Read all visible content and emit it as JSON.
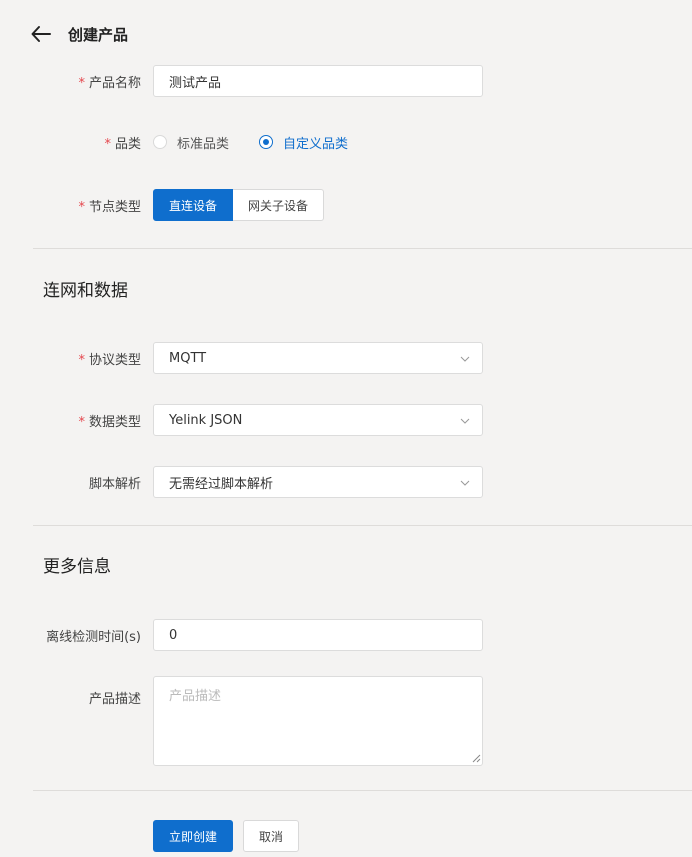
{
  "header": {
    "title": "创建产品",
    "back_icon": "arrow-left-icon"
  },
  "basic": {
    "product_name": {
      "label": "产品名称",
      "required": "*",
      "value": "测试产品"
    },
    "category": {
      "label": "品类",
      "required": "*",
      "options": [
        {
          "label": "标准品类",
          "checked": false
        },
        {
          "label": "自定义品类",
          "checked": true
        }
      ]
    },
    "node_type": {
      "label": "节点类型",
      "required": "*",
      "options": [
        {
          "label": "直连设备",
          "active": true
        },
        {
          "label": "网关子设备",
          "active": false
        }
      ]
    }
  },
  "network": {
    "title": "连网和数据",
    "protocol": {
      "label": "协议类型",
      "required": "*",
      "value": "MQTT"
    },
    "data_type": {
      "label": "数据类型",
      "required": "*",
      "value": "Yelink JSON"
    },
    "script": {
      "label": "脚本解析",
      "value": "无需经过脚本解析"
    }
  },
  "more": {
    "title": "更多信息",
    "offline": {
      "label": "离线检测时间(s)",
      "value": "0"
    },
    "description": {
      "label": "产品描述",
      "placeholder": "产品描述",
      "value": ""
    }
  },
  "actions": {
    "submit": "立即创建",
    "cancel": "取消"
  },
  "colors": {
    "primary": "#0f6ecd",
    "required": "#e5474d",
    "background": "#f4f3f2"
  }
}
